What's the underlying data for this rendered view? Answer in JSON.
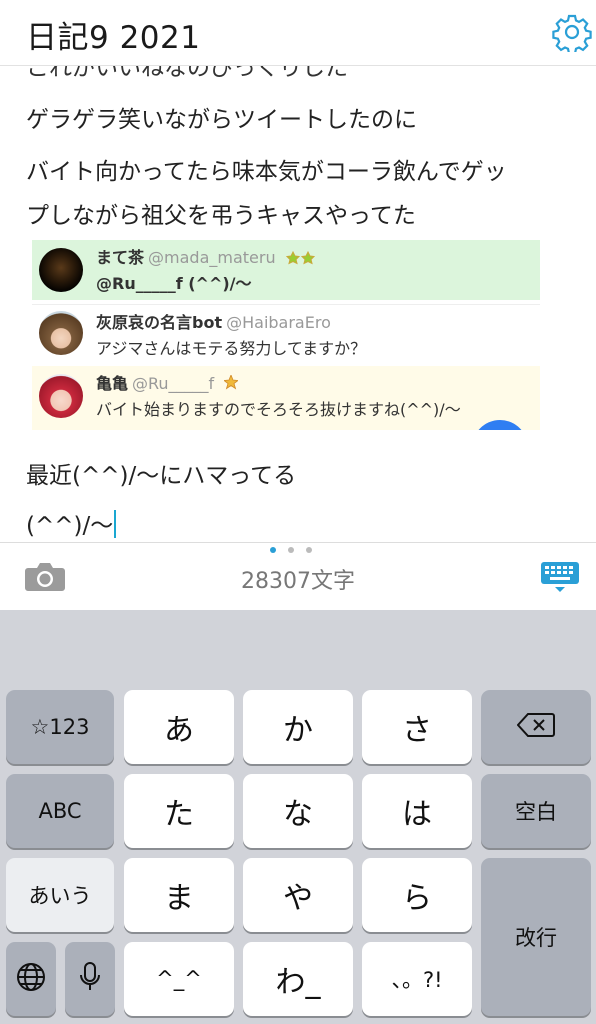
{
  "header": {
    "title": "日記9 2021",
    "settings_icon": "gear-icon"
  },
  "editor": {
    "clipped_line": "これがいいねなのびっくりした",
    "lines": [
      "ゲラゲラ笑いながらツイートしたのに",
      "バイト向かってたら味本気がコーラ飲んでゲッ",
      "プしながら祖父を弔うキャスやってた"
    ],
    "after_lines": [
      "最近(^^)/〜にハマってる",
      "(^^)/〜"
    ]
  },
  "tweets": [
    {
      "name": "まて茶",
      "handle": "@mada_materu",
      "text": "@Ru_____f (^^)/〜"
    },
    {
      "name": "灰原哀の名言bot",
      "handle": "@HaibaraEro",
      "text": "アジマさんはモテる努力してますか？"
    },
    {
      "name": "亀亀",
      "handle": "@Ru_____f",
      "text": "バイト始まりますのでそろそろ抜けますね(^^)/〜"
    }
  ],
  "toolbar": {
    "char_count": "28307文字",
    "camera_icon": "camera-icon",
    "keyboard_icon": "keyboard-icon",
    "page_dots": 3,
    "active_dot": 0
  },
  "keyboard": {
    "keys": {
      "k123": "☆123",
      "a": "あ",
      "ka": "か",
      "sa": "さ",
      "abc": "ABC",
      "ta": "た",
      "na": "な",
      "ha": "は",
      "space": "空白",
      "aiu": "あいう",
      "ma": "ま",
      "ya": "や",
      "ra": "ら",
      "enter": "改行",
      "dakuten": "^_^",
      "wa": "わ_",
      "punct": "、。?!"
    }
  },
  "colors": {
    "accent": "#2a9fd6",
    "keyboard_bg": "#d1d3d9",
    "key_gray": "#abb0ba",
    "tweet1_bg": "#dcf5dc",
    "tweet3_bg": "#fffbe8"
  }
}
